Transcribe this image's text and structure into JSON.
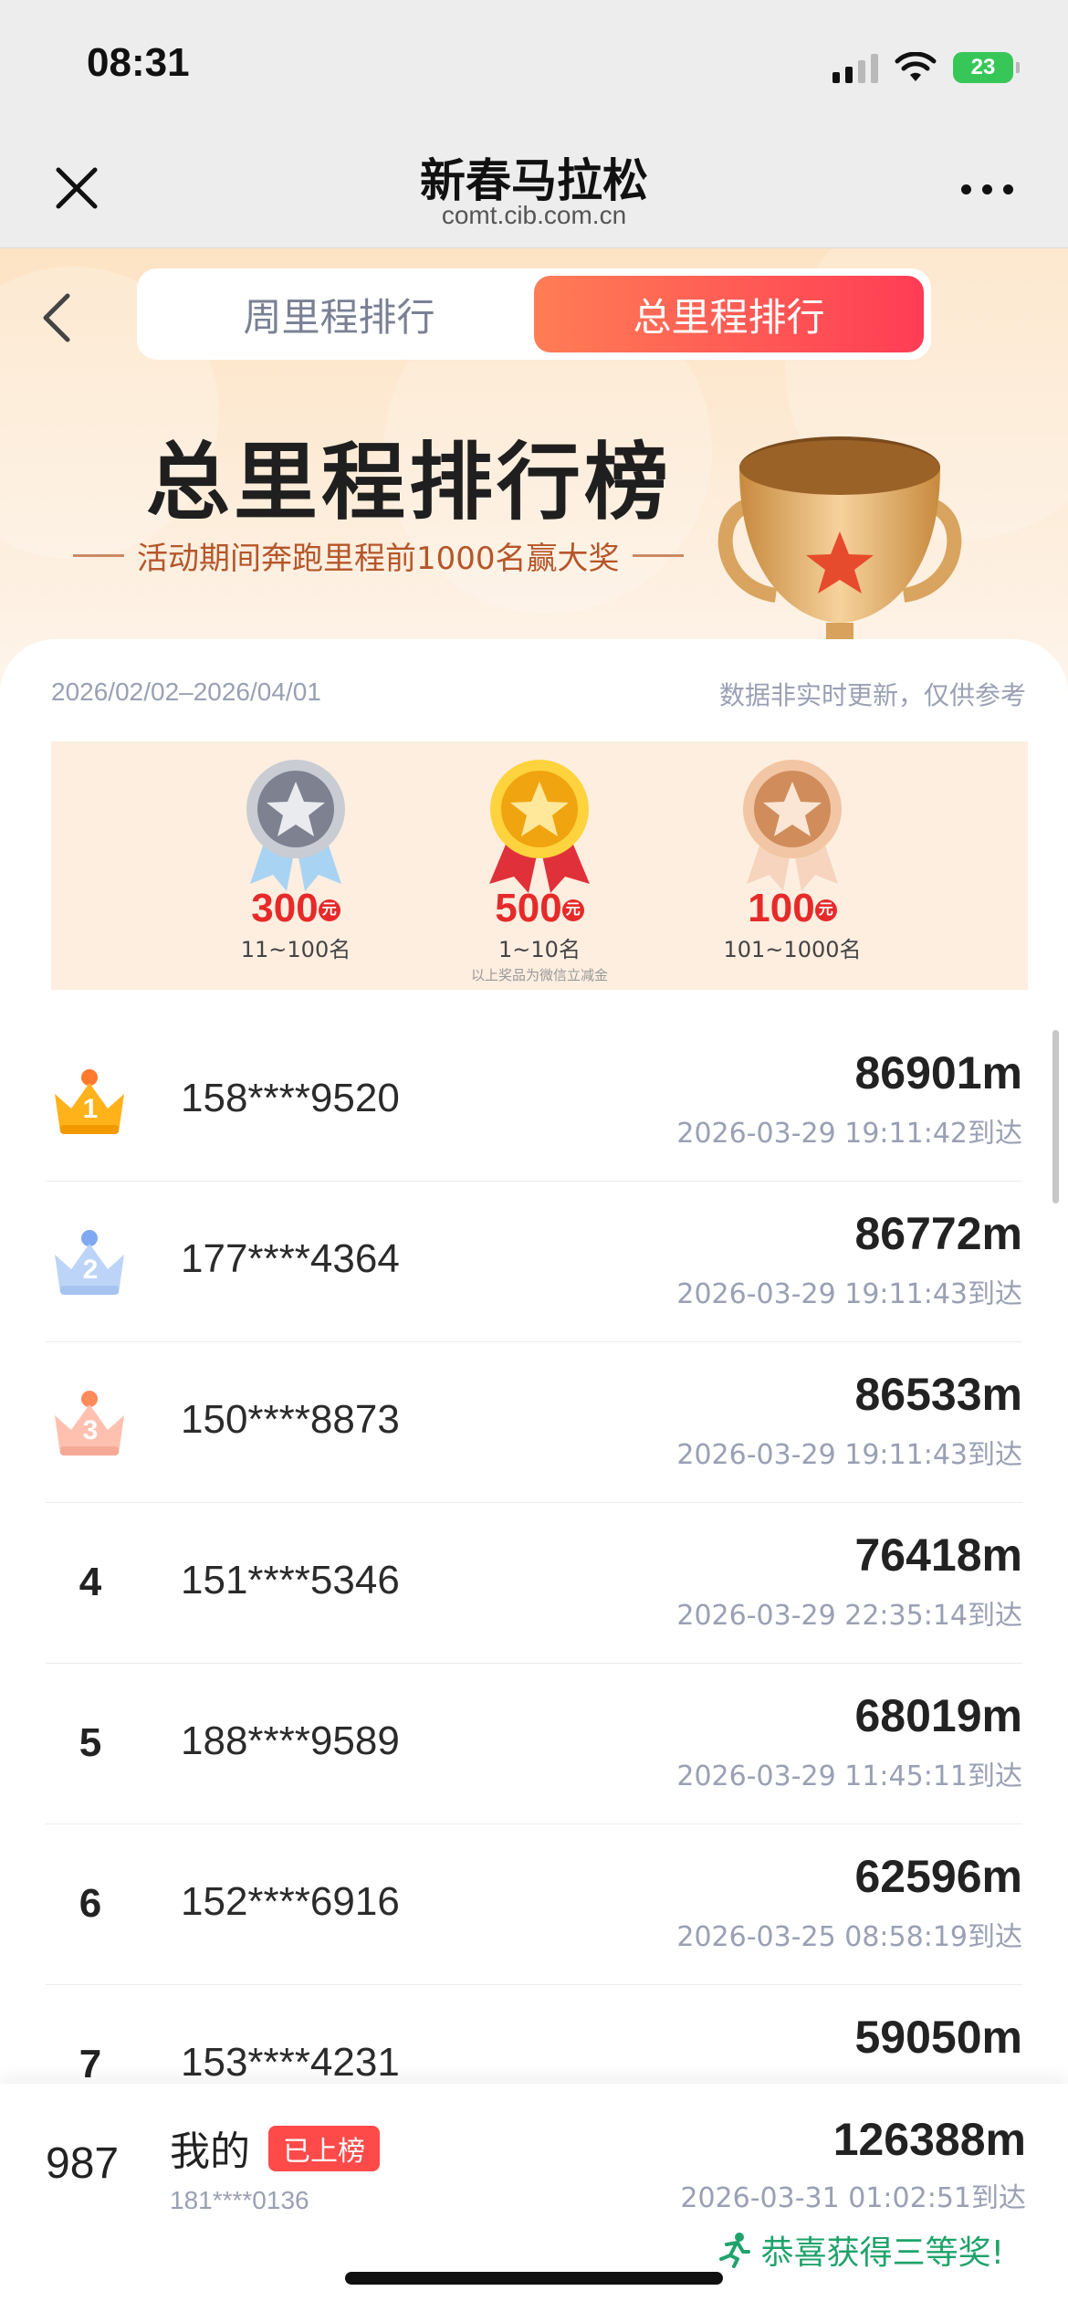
{
  "status_bar": {
    "time": "08:31",
    "battery": "23",
    "icons": [
      "signal-icon",
      "wifi-icon",
      "battery-charging-icon"
    ]
  },
  "nav": {
    "title": "新春马拉松",
    "subtitle": "comt.cib.com.cn",
    "close_icon": "close-icon",
    "more_icon": "more-icon"
  },
  "tabs": [
    {
      "label": "周里程排行",
      "active": false
    },
    {
      "label": "总里程排行",
      "active": true
    }
  ],
  "hero": {
    "title": "总里程排行榜",
    "subtitle": "活动期间奔跑里程前1000名赢大奖"
  },
  "meta": {
    "date_range": "2026/02/02–2026/04/01",
    "disclaimer": "数据非实时更新，仅供参考"
  },
  "prizes": {
    "items": [
      {
        "amount": "300",
        "unit": "元",
        "rank": "11~100名",
        "medal": "silver-medal-icon"
      },
      {
        "amount": "500",
        "unit": "元",
        "rank": "1~10名",
        "medal": "gold-medal-icon"
      },
      {
        "amount": "100",
        "unit": "元",
        "rank": "101~1000名",
        "medal": "bronze-medal-icon"
      }
    ],
    "note": "以上奖品为微信立减金"
  },
  "ranking": [
    {
      "rank": "1",
      "phone": "158****9520",
      "distance": "86901m",
      "time": "2026-03-29 19:11:42到达",
      "badge": "gold-crown-icon"
    },
    {
      "rank": "2",
      "phone": "177****4364",
      "distance": "86772m",
      "time": "2026-03-29 19:11:43到达",
      "badge": "silver-crown-icon"
    },
    {
      "rank": "3",
      "phone": "150****8873",
      "distance": "86533m",
      "time": "2026-03-29 19:11:43到达",
      "badge": "bronze-crown-icon"
    },
    {
      "rank": "4",
      "phone": "151****5346",
      "distance": "76418m",
      "time": "2026-03-29 22:35:14到达"
    },
    {
      "rank": "5",
      "phone": "188****9589",
      "distance": "68019m",
      "time": "2026-03-29 11:45:11到达"
    },
    {
      "rank": "6",
      "phone": "152****6916",
      "distance": "62596m",
      "time": "2026-03-25 08:58:19到达"
    },
    {
      "rank": "7",
      "phone": "153****4231",
      "distance": "59050m",
      "time": ""
    }
  ],
  "mine": {
    "rank": "987",
    "label": "我的",
    "tag": "已上榜",
    "phone": "181****0136",
    "distance": "126388m",
    "time": "2026-03-31 01:02:51到达",
    "congrats": "恭喜获得三等奖!"
  },
  "colors": {
    "accent": "#ff4a55",
    "tab_gradient_start": "#ff7d55",
    "tab_gradient_end": "#ff3d55",
    "congrats": "#1fa36b",
    "muted": "#9aa0b4",
    "prize_red": "#e62a2a"
  }
}
